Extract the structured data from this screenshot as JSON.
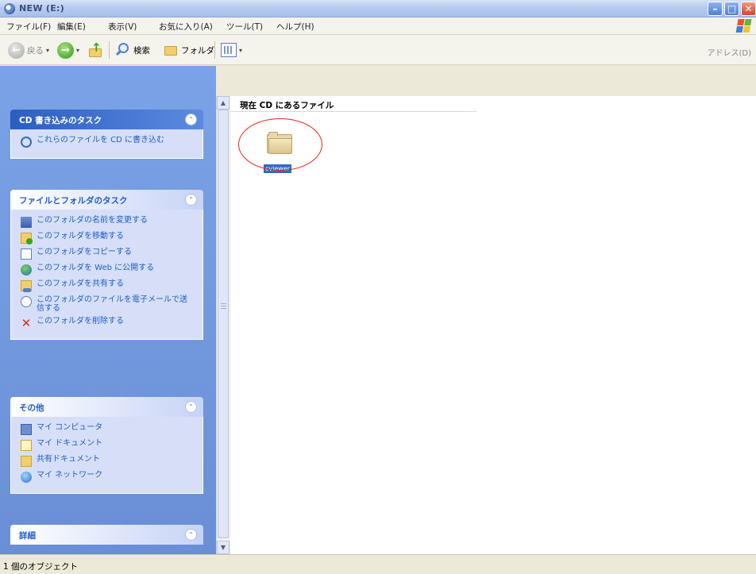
{
  "window": {
    "title": "NEW (E:)"
  },
  "menu": [
    "ファイル(F)",
    "編集(E)",
    "表示(V)",
    "お気に入り(A)",
    "ツール(T)",
    "ヘルプ(H)"
  ],
  "toolbar": {
    "back_label": "戻る",
    "search_label": "検索",
    "folders_label": "フォルダ",
    "address_label": "アドレス(D)"
  },
  "tasks": {
    "cd": {
      "title": "CD 書き込みのタスク",
      "items": [
        "これらのファイルを CD に書き込む"
      ]
    },
    "file_folder": {
      "title": "ファイルとフォルダのタスク",
      "items": [
        "このフォルダの名前を変更する",
        "このフォルダを移動する",
        "このフォルダをコピーする",
        "このフォルダを Web に公開する",
        "このフォルダを共有する",
        "このフォルダのファイルを電子メールで送信する",
        "このフォルダを削除する"
      ]
    },
    "other": {
      "title": "その他",
      "items": [
        "マイ コンピュータ",
        "マイ ドキュメント",
        "共有ドキュメント",
        "マイ ネットワーク"
      ]
    },
    "details": {
      "title": "詳細"
    }
  },
  "content": {
    "header": "現在 CD にあるファイル",
    "items": [
      {
        "name": "cviewer"
      }
    ]
  },
  "status": {
    "text": "1 個のオブジェクト"
  }
}
